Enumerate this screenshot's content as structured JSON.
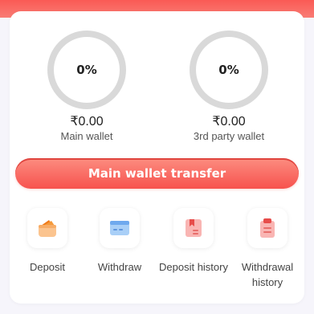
{
  "wallets": {
    "main": {
      "percent": "0%",
      "amount": "₹0.00",
      "label": "Main wallet"
    },
    "third_party": {
      "percent": "0%",
      "amount": "₹0.00",
      "label": "3rd party wallet"
    }
  },
  "transfer_button_label": "Main wallet transfer",
  "actions": [
    {
      "label": "Deposit",
      "icon": "wallet-icon"
    },
    {
      "label": "Withdraw",
      "icon": "card-icon"
    },
    {
      "label": "Deposit history",
      "icon": "bookmark-document-icon"
    },
    {
      "label": "Withdrawal history",
      "icon": "clipboard-icon"
    }
  ],
  "colors": {
    "accent": "#f7524e",
    "ring": "#d9d9d9",
    "background": "#f6f5fb"
  }
}
